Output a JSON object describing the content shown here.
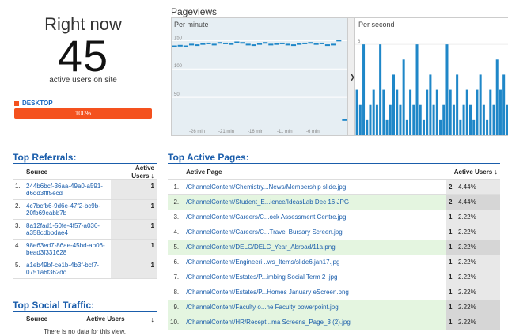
{
  "right_now": {
    "title": "Right now",
    "count": "45",
    "label": "active users on site",
    "device_label": "DESKTOP",
    "device_percent": "100%",
    "device_color": "#f4511e"
  },
  "pageviews": {
    "title": "Pageviews",
    "per_minute_label": "Per minute",
    "per_second_label": "Per second",
    "y_ticks": [
      "150",
      "100",
      "50"
    ],
    "x_ticks": [
      "-26 min",
      "-21 min",
      "-16 min",
      "-11 min",
      "-6 min"
    ],
    "per_second_y_tick": "6",
    "per_minute_values": [
      140,
      141,
      140,
      143,
      142,
      144,
      145,
      143,
      146,
      145,
      144,
      147,
      146,
      143,
      142,
      144,
      146,
      143,
      144,
      145,
      143,
      142,
      144,
      145,
      146,
      144,
      145,
      142,
      143,
      150,
      10
    ],
    "per_second_values": [
      3,
      2,
      6,
      1,
      2,
      3,
      2,
      6,
      3,
      1,
      2,
      4,
      3,
      2,
      5,
      1,
      3,
      2,
      6,
      2,
      1,
      3,
      4,
      2,
      3,
      1,
      2,
      6,
      3,
      2,
      4,
      1,
      2,
      3,
      2,
      1,
      3,
      4,
      2,
      1,
      3,
      2,
      5,
      3,
      4,
      2
    ],
    "accent": "#1f87c8"
  },
  "top_referrals": {
    "title": "Top Referrals:",
    "col_source": "Source",
    "col_users": "Active Users",
    "rows": [
      {
        "n": "1.",
        "source": "244b6bcf-36aa-49a0-a591-d6dd3fff5ecd",
        "users": "1"
      },
      {
        "n": "2.",
        "source": "4c7bcfb6-9d6e-47f2-bc9b-20fb69eabb7b",
        "users": "1"
      },
      {
        "n": "3.",
        "source": "8a12fad1-50fe-4f57-a036-a358cdbbdae4",
        "users": "1"
      },
      {
        "n": "4.",
        "source": "98e63ed7-86ae-45bd-ab06-bead3f331628",
        "users": "1"
      },
      {
        "n": "5.",
        "source": "a1eb49bf-ce1b-4b3f-bcf7-0751a6f362dc",
        "users": "1"
      }
    ]
  },
  "top_social": {
    "title": "Top Social Traffic:",
    "col_source": "Source",
    "col_users": "Active Users",
    "empty": "There is no data for this view."
  },
  "top_pages": {
    "title": "Top Active Pages:",
    "col_page": "Active Page",
    "col_users": "Active Users",
    "rows": [
      {
        "n": "1.",
        "page": "/ChannelContent/Chemistry...News/Membership slide.jpg",
        "count": "2",
        "pct": "4.44%",
        "green": false
      },
      {
        "n": "2.",
        "page": "/ChannelContent/Student_E...ience/IdeasLab Dec 16.JPG",
        "count": "2",
        "pct": "4.44%",
        "green": true
      },
      {
        "n": "3.",
        "page": "/ChannelContent/Careers/C...ock Assessment Centre.jpg",
        "count": "1",
        "pct": "2.22%",
        "green": false
      },
      {
        "n": "4.",
        "page": "/ChannelContent/Careers/C...Travel Bursary Screen.jpg",
        "count": "1",
        "pct": "2.22%",
        "green": false
      },
      {
        "n": "5.",
        "page": "/ChannelContent/DELC/DELC_Year_Abroad/11a.png",
        "count": "1",
        "pct": "2.22%",
        "green": true
      },
      {
        "n": "6.",
        "page": "/ChannelContent/Engineeri...ws_Items/slide6.jan17.jpg",
        "count": "1",
        "pct": "2.22%",
        "green": false
      },
      {
        "n": "7.",
        "page": "/ChannelContent/Estates/P...imbing Social Term 2 .jpg",
        "count": "1",
        "pct": "2.22%",
        "green": false
      },
      {
        "n": "8.",
        "page": "/ChannelContent/Estates/P...Homes January eScreen.png",
        "count": "1",
        "pct": "2.22%",
        "green": false
      },
      {
        "n": "9.",
        "page": "/ChannelContent/Faculty o...he Faculty powerpoint.jpg",
        "count": "1",
        "pct": "2.22%",
        "green": true
      },
      {
        "n": "10.",
        "page": "/ChannelContent/HR/Recept...ma Screens_Page_3 (2).jpg",
        "count": "1",
        "pct": "2.22%",
        "green": true
      }
    ]
  }
}
